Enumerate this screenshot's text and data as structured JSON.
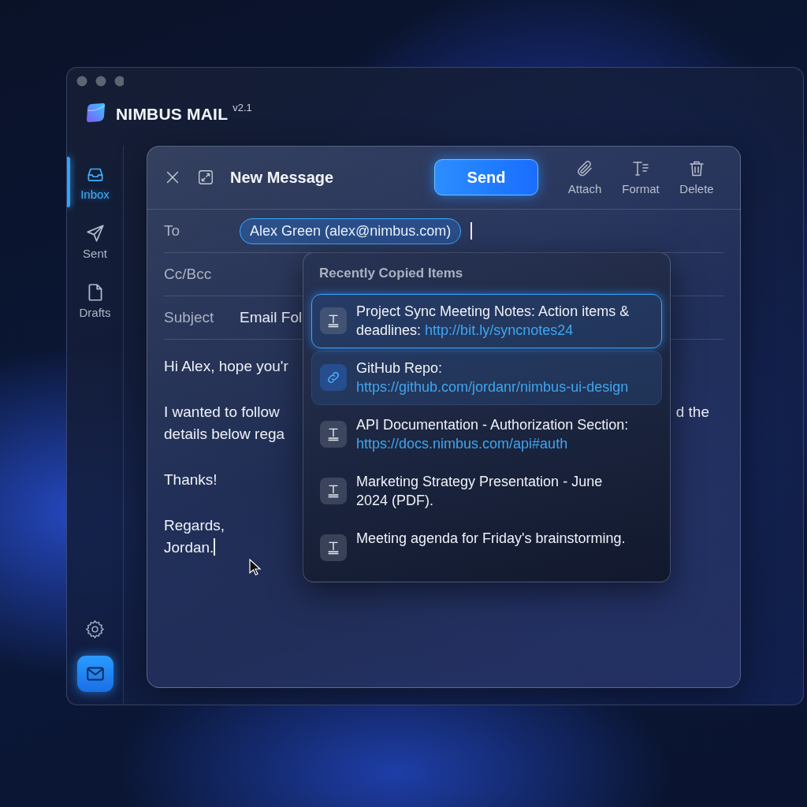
{
  "window": {
    "brand": "NIMBUS MAIL",
    "version": "v2.1"
  },
  "sidebar": {
    "items": [
      {
        "kind": "inbox",
        "label": "Inbox",
        "selected": true
      },
      {
        "kind": "send",
        "label": "Sent",
        "selected": false
      },
      {
        "kind": "draft",
        "label": "Drafts",
        "selected": false
      }
    ]
  },
  "compose": {
    "title": "New Message",
    "send": "Send",
    "actions": [
      {
        "kind": "attach",
        "label": "Attach"
      },
      {
        "kind": "format",
        "label": "Format"
      },
      {
        "kind": "delete",
        "label": "Delete"
      }
    ],
    "fields": [
      {
        "kind": "recipients",
        "label": "To",
        "chips": [
          "Alex Green (alex@nimbus.com)"
        ],
        "caret": true
      },
      {
        "kind": "text",
        "label": "Cc/Bcc"
      },
      {
        "kind": "text",
        "label": "Subject",
        "value": "Email Fol"
      }
    ],
    "body": [
      [
        {
          "left": "Hi Alex, hope you'r"
        }
      ],
      [
        {
          "left": "I wanted to follow",
          "right": "d the"
        },
        {
          "left": "details below rega"
        }
      ],
      [
        {
          "left": "Thanks!"
        }
      ],
      [
        {
          "left": "Regards,"
        },
        {
          "left": "Jordan.",
          "caret": true
        }
      ]
    ]
  },
  "clipboard": {
    "title": "Recently Copied Items",
    "items": [
      {
        "kind": "text",
        "text": "Project Sync Meeting Notes: Action items & deadlines:",
        "link": "http://bit.ly/syncnotes24",
        "selected": true,
        "hovered": false
      },
      {
        "kind": "link",
        "text": "GitHub Repo:",
        "link": "https://github.com/jordanr/nimbus-ui-design",
        "selected": false,
        "hovered": true
      },
      {
        "kind": "text",
        "text": "API Documentation - Authorization Section:",
        "link": "https://docs.nimbus.com/api#auth",
        "selected": false,
        "hovered": false
      },
      {
        "kind": "text",
        "text": "Marketing Strategy Presentation - June 2024 (PDF).",
        "selected": false,
        "hovered": false
      },
      {
        "kind": "text",
        "text": "Meeting agenda for Friday's brainstorming.",
        "selected": false,
        "hovered": false
      }
    ]
  }
}
